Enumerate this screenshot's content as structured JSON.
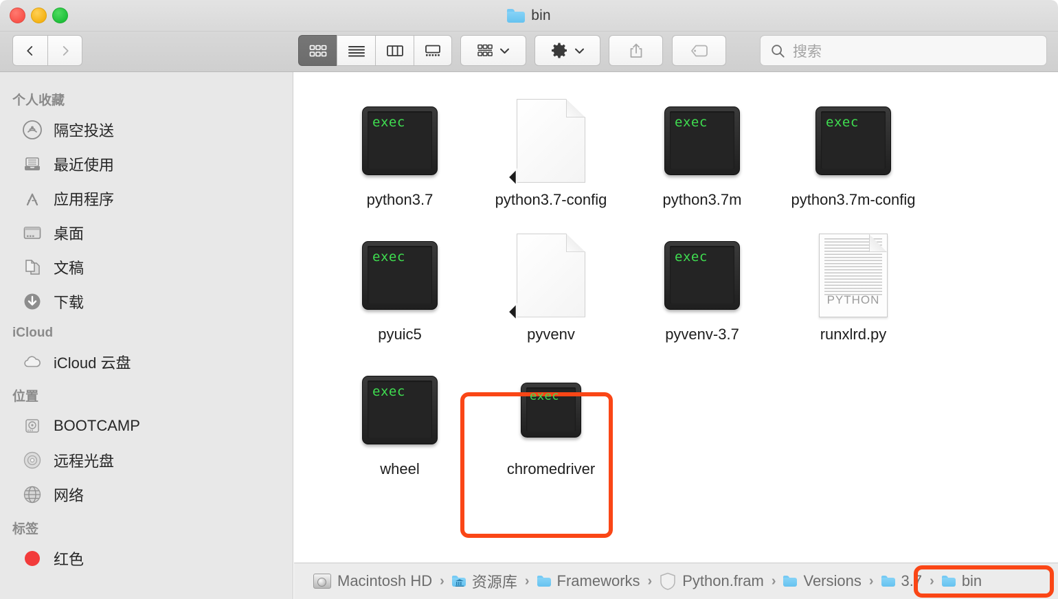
{
  "window": {
    "title": "bin",
    "title_icon": "folder-icon"
  },
  "traffic_lights": {
    "close": "close-button",
    "minimize": "minimize-button",
    "zoom": "zoom-button"
  },
  "toolbar": {
    "back_label": "back-icon",
    "forward_label": "forward-icon",
    "view_modes": [
      {
        "name": "icon-view",
        "icon": "grid-icon",
        "active": true
      },
      {
        "name": "list-view",
        "icon": "list-icon",
        "active": false
      },
      {
        "name": "column-view",
        "icon": "columns-icon",
        "active": false
      },
      {
        "name": "gallery-view",
        "icon": "gallery-icon",
        "active": false
      }
    ],
    "arrange_button": "arrange-icon",
    "action_button": "gear-icon",
    "share_button": "share-icon",
    "tag_button": "tag-icon"
  },
  "search": {
    "placeholder": "搜索",
    "value": "",
    "icon": "search-icon"
  },
  "sidebar": {
    "sections": [
      {
        "header": "个人收藏",
        "items": [
          {
            "label": "隔空投送",
            "icon": "airdrop-icon"
          },
          {
            "label": "最近使用",
            "icon": "recents-icon"
          },
          {
            "label": "应用程序",
            "icon": "applications-icon"
          },
          {
            "label": "桌面",
            "icon": "desktop-icon"
          },
          {
            "label": "文稿",
            "icon": "documents-icon"
          },
          {
            "label": "下载",
            "icon": "downloads-icon"
          }
        ]
      },
      {
        "header": "iCloud",
        "items": [
          {
            "label": "iCloud 云盘",
            "icon": "cloud-icon"
          }
        ]
      },
      {
        "header": "位置",
        "items": [
          {
            "label": "BOOTCAMP",
            "icon": "harddisk-icon"
          },
          {
            "label": "远程光盘",
            "icon": "disc-icon"
          },
          {
            "label": "网络",
            "icon": "network-icon"
          }
        ]
      },
      {
        "header": "标签",
        "items": [
          {
            "label": "红色",
            "icon": "red-tag-icon"
          }
        ]
      }
    ]
  },
  "files": [
    {
      "label": "python3.7",
      "icon": "unix-executable-icon",
      "badge": "exec",
      "highlighted": false
    },
    {
      "label": "python3.7-config",
      "icon": "alias-document-icon",
      "badge": "",
      "highlighted": false
    },
    {
      "label": "python3.7m",
      "icon": "unix-executable-icon",
      "badge": "exec",
      "highlighted": false
    },
    {
      "label": "python3.7m-config",
      "icon": "unix-executable-icon",
      "badge": "exec",
      "highlighted": false
    },
    {
      "label": "pyuic5",
      "icon": "unix-executable-icon",
      "badge": "exec",
      "highlighted": false
    },
    {
      "label": "pyvenv",
      "icon": "alias-document-icon",
      "badge": "",
      "highlighted": false
    },
    {
      "label": "pyvenv-3.7",
      "icon": "unix-executable-icon",
      "badge": "exec",
      "highlighted": false
    },
    {
      "label": "runxlrd.py",
      "icon": "python-source-icon",
      "badge": "PYTHON",
      "highlighted": false
    },
    {
      "label": "wheel",
      "icon": "unix-executable-icon",
      "badge": "exec",
      "highlighted": false
    },
    {
      "label": "chromedriver",
      "icon": "unix-executable-icon",
      "badge": "exec",
      "highlighted": true
    }
  ],
  "path_bar": {
    "crumbs": [
      {
        "label": "Macintosh HD",
        "icon": "harddisk-icon",
        "highlighted": false
      },
      {
        "label": "资源库",
        "icon": "library-folder-icon",
        "highlighted": false
      },
      {
        "label": "Frameworks",
        "icon": "folder-icon",
        "highlighted": false
      },
      {
        "label": "Python.fram",
        "icon": "framework-icon",
        "highlighted": false
      },
      {
        "label": "Versions",
        "icon": "folder-icon",
        "highlighted": false
      },
      {
        "label": "3.7",
        "icon": "folder-icon",
        "highlighted": true
      },
      {
        "label": "bin",
        "icon": "folder-icon",
        "highlighted": true
      }
    ],
    "separator": "›"
  },
  "annotations": {
    "accent_color": "#fa4616",
    "boxes": [
      {
        "name": "chromedriver-highlight",
        "target": "chromedriver"
      },
      {
        "name": "path-highlight",
        "target": "3.7 › bin"
      }
    ]
  }
}
